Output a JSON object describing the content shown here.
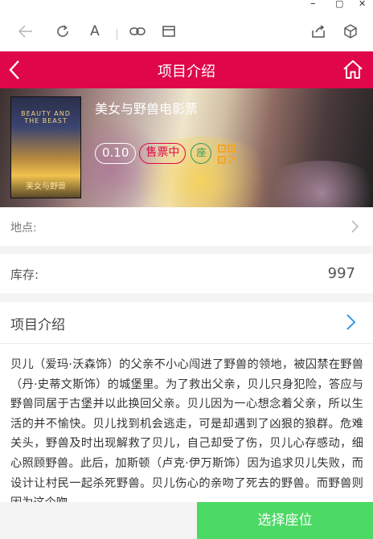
{
  "window": {
    "minimize_glyph": "–",
    "maximize_glyph": "▢",
    "close_glyph": "✕"
  },
  "toolbar": {
    "icons": [
      "back-arrow-icon",
      "refresh-icon",
      "font-size-icon",
      "link-icon",
      "window-icon",
      "share-icon",
      "cube-icon"
    ],
    "font_glyph": "A"
  },
  "header": {
    "title": "项目介绍",
    "color": "#e0064a"
  },
  "banner": {
    "movie_name": "美女与野兽电影票",
    "price": "0.10",
    "sale_status": "售票中",
    "seat_tag": "座",
    "poster_title": "BEAUTY AND THE BEAST",
    "poster_subtitle": "美女与野兽"
  },
  "location": {
    "label": "地点:"
  },
  "stock": {
    "label": "库存:",
    "value": "997"
  },
  "intro": {
    "label": "项目介绍",
    "text": "贝儿（爱玛·沃森饰）的父亲不小心闯进了野兽的领地，被囚禁在野兽（丹·史蒂文斯饰）的城堡里。为了救出父亲，贝儿只身犯险，答应与野兽同居于古堡并以此换回父亲。贝儿因为一心想念着父亲，所以生活的并不愉快。贝儿找到机会逃走，可是却遇到了凶狠的狼群。危难关头，野兽及时出现解救了贝儿，自己却受了伤，贝儿心存感动，细心照顾野兽。此后，加斯顿（卢克·伊万斯饰）因为追求贝儿失败，而设计让村民一起杀死野兽。贝儿伤心的亲吻了死去的野兽。而野兽则因为这个吻，"
  },
  "action": {
    "select_seat": "选择座位",
    "color": "#4cd964"
  }
}
